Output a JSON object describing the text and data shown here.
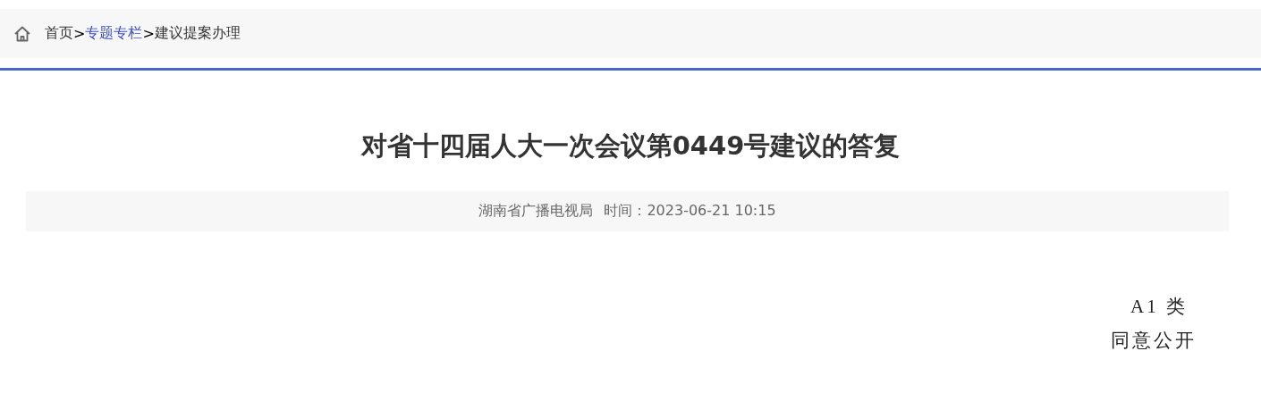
{
  "breadcrumb": [
    {
      "kind": "home_icon"
    },
    {
      "kind": "item",
      "label": "首页"
    },
    {
      "kind": "sep",
      "label": ">"
    },
    {
      "kind": "link",
      "label": "专题专栏"
    },
    {
      "kind": "sep",
      "label": ">"
    },
    {
      "kind": "item",
      "label": "建议提案办理"
    }
  ],
  "article": {
    "title": "对省十四届人大一次会议第0449号建议的答复",
    "source": "湖南省广播电视局",
    "time": "时间：2023-06-21 10:15",
    "body": [
      "A1 类",
      "同意公开"
    ]
  }
}
